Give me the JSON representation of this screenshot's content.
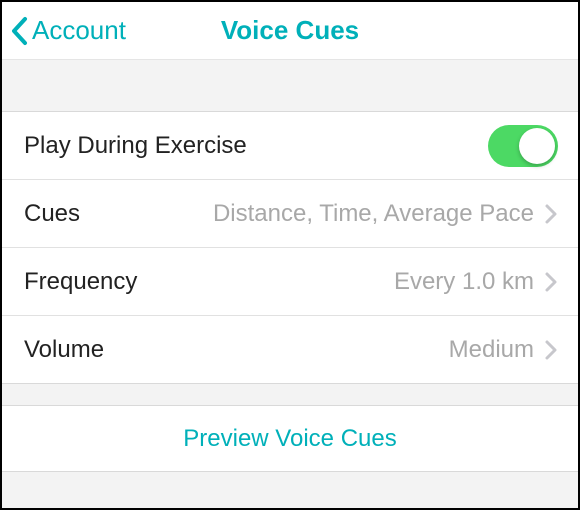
{
  "nav": {
    "back_label": "Account",
    "title": "Voice Cues"
  },
  "settings": {
    "play_during_exercise": {
      "label": "Play During Exercise",
      "enabled": true
    },
    "cues": {
      "label": "Cues",
      "value": "Distance, Time, Average Pace"
    },
    "frequency": {
      "label": "Frequency",
      "value": "Every 1.0 km"
    },
    "volume": {
      "label": "Volume",
      "value": "Medium"
    }
  },
  "action": {
    "preview_label": "Preview Voice Cues"
  },
  "colors": {
    "accent": "#00b0b9",
    "toggle_on": "#4cd964"
  }
}
